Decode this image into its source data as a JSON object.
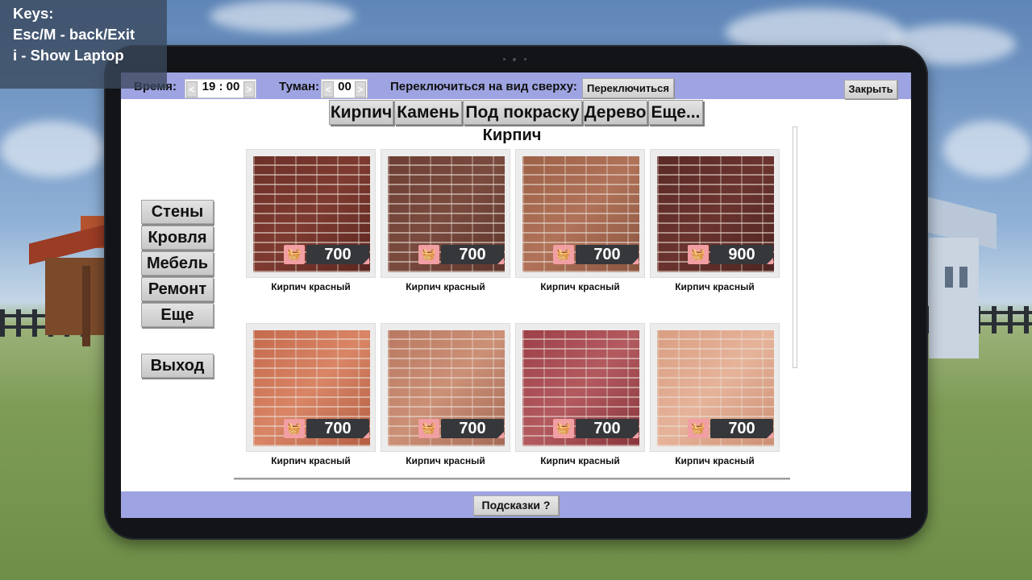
{
  "keys": {
    "line1": "Keys:",
    "line2": "Esc/M - back/Exit",
    "line3": "i - Show Laptop"
  },
  "topbar": {
    "time_label": "Время:",
    "time_value": "19 : 00",
    "fog_label": "Туман:",
    "fog_value": "00",
    "switch_label": "Переключиться на вид сверху:",
    "switch_button": "Переключиться",
    "close_button": "Закрыть",
    "spin_prev": "<",
    "spin_next": ">"
  },
  "tabs": [
    "Кирпич",
    "Камень",
    "Под покраску",
    "Дерево",
    "Еще..."
  ],
  "sidebar": [
    "Стены",
    "Кровля",
    "Мебель",
    "Ремонт",
    "Еще"
  ],
  "exit_button": "Выход",
  "section_title": "Кирпич",
  "cart_icon": "basket-icon",
  "items": [
    {
      "name": "Кирпич красный",
      "price": "700"
    },
    {
      "name": "Кирпич красный",
      "price": "700"
    },
    {
      "name": "Кирпич красный",
      "price": "700"
    },
    {
      "name": "Кирпич красный",
      "price": "900"
    },
    {
      "name": "Кирпич красный",
      "price": "700"
    },
    {
      "name": "Кирпич красный",
      "price": "700"
    },
    {
      "name": "Кирпич красный",
      "price": "700"
    },
    {
      "name": "Кирпич красный",
      "price": "700"
    }
  ],
  "hints_button": "Подсказки ?",
  "colors": {
    "bar": "#9ea4e2",
    "price_bg": "#35373b",
    "cart_bg": "#f19fa3"
  }
}
